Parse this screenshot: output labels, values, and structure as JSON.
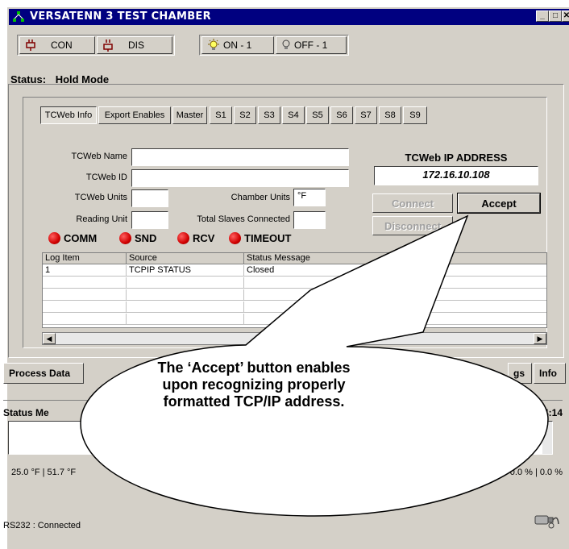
{
  "window": {
    "title": "VERSATENN 3 TEST CHAMBER",
    "controls": {
      "minimize": "_",
      "maximize": "□",
      "close": "✕"
    }
  },
  "toolbar": {
    "con_label": "CON",
    "dis_label": "DIS",
    "on_label": "ON - 1",
    "off_label": "OFF - 1"
  },
  "status": {
    "label": "Status:",
    "value": "Hold Mode"
  },
  "tabs": [
    "TCWeb Info",
    "Export Enables",
    "Master",
    "S1",
    "S2",
    "S3",
    "S4",
    "S5",
    "S6",
    "S7",
    "S8",
    "S9"
  ],
  "form": {
    "tcweb_name_label": "TCWeb Name",
    "tcweb_name_value": "",
    "tcweb_id_label": "TCWeb ID",
    "tcweb_id_value": "",
    "tcweb_units_label": "TCWeb Units",
    "tcweb_units_value": "",
    "chamber_units_label": "Chamber Units",
    "chamber_units_value": "°F",
    "reading_unit_label": "Reading Unit",
    "reading_unit_value": "",
    "total_slaves_label": "Total Slaves Connected",
    "total_slaves_value": "",
    "ip_heading": "TCWeb IP ADDRESS",
    "ip_value": "172.16.10.108",
    "connect_label": "Connect",
    "accept_label": "Accept",
    "disconnect_label": "Disconnect"
  },
  "indicators": [
    "COMM",
    "SND",
    "RCV",
    "TIMEOUT"
  ],
  "log": {
    "columns": [
      "Log Item",
      "Source",
      "Status Message"
    ],
    "rows": [
      {
        "item": "1",
        "source": "TCPIP STATUS",
        "message": "Closed"
      }
    ]
  },
  "process_tabs": {
    "process_data": "Process Data",
    "settings": "gs",
    "info": "Info"
  },
  "messages": {
    "title": "Status Me",
    "time": "4:14",
    "temp_left": "25.0 °F  |  51.7 °F",
    "percent_right": "0.0 %  |  0.0 %"
  },
  "statusbar": {
    "text": "RS232 : Connected"
  },
  "callout": {
    "line1": "The ‘Accept’ button enables",
    "line2": "upon recognizing properly",
    "line3": "formatted TCP/IP address."
  },
  "colors": {
    "titlebar": "#000080",
    "face": "#d4d0c8",
    "led": "#d00000"
  }
}
